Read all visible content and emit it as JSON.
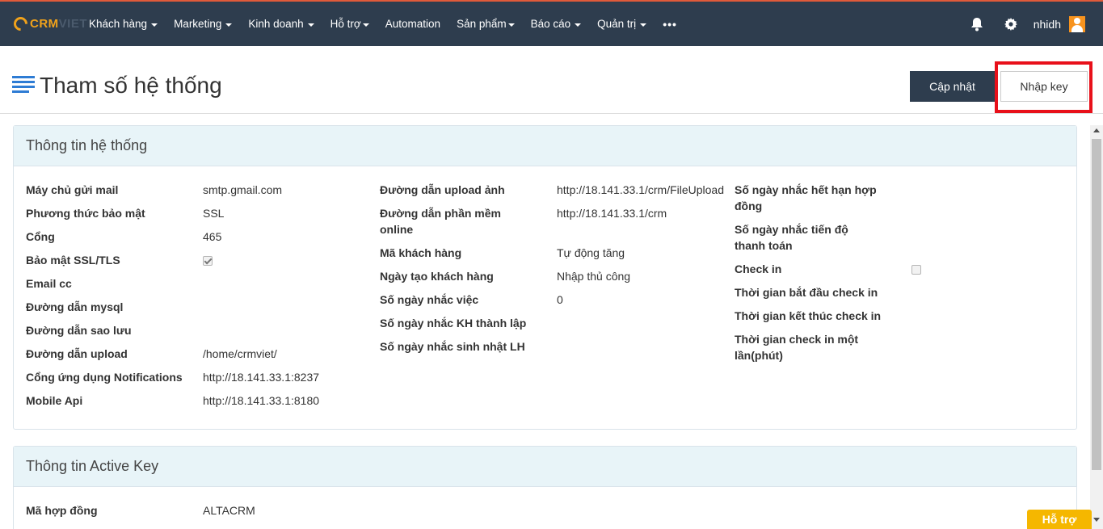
{
  "logo": {
    "part1": "CRM",
    "part2": "VIET"
  },
  "nav": {
    "items": [
      {
        "label": "Khách hàng",
        "dropdown": true
      },
      {
        "label": "Marketing",
        "dropdown": true
      },
      {
        "label": "Kinh doanh",
        "dropdown": true
      },
      {
        "label": "Hỗ trợ",
        "dropdown": true
      },
      {
        "label": "Automation",
        "dropdown": false
      },
      {
        "label": "Sản phẩm",
        "dropdown": true
      },
      {
        "label": "Báo cáo",
        "dropdown": true
      },
      {
        "label": "Quản trị",
        "dropdown": true
      }
    ],
    "more": "•••",
    "username": "nhidh",
    "icons": {
      "notifications": "bell-icon",
      "settings": "gear-icon",
      "user": "avatar-icon",
      "menu": "list-icon"
    }
  },
  "header": {
    "title": "Tham số hệ thống",
    "update_button": "Cập nhật",
    "key_button": "Nhập key"
  },
  "system_panel": {
    "title": "Thông tin hệ thống",
    "col1": [
      {
        "label": "Máy chủ gửi mail",
        "value": "smtp.gmail.com"
      },
      {
        "label": "Phương thức bảo mật",
        "value": "SSL"
      },
      {
        "label": "Cổng",
        "value": "465"
      },
      {
        "label": "Bảo mật SSL/TLS",
        "value": "",
        "checkbox": true,
        "checked": true
      },
      {
        "label": "Email cc",
        "value": ""
      },
      {
        "label": "Đường dẫn mysql",
        "value": ""
      },
      {
        "label": "Đường dẫn sao lưu",
        "value": ""
      },
      {
        "label": "Đường dẫn upload",
        "value": "/home/crmviet/"
      },
      {
        "label": "Cổng ứng dụng Notifications",
        "value": "http://18.141.33.1:8237"
      },
      {
        "label": "Mobile Api",
        "value": "http://18.141.33.1:8180"
      }
    ],
    "col2": [
      {
        "label": "Đường dẫn upload ảnh",
        "value": "http://18.141.33.1/crm/FileUpload"
      },
      {
        "label": "Đường dẫn phần mềm online",
        "value": "http://18.141.33.1/crm"
      },
      {
        "label": "Mã khách hàng",
        "value": "Tự động tăng"
      },
      {
        "label": "Ngày tạo khách hàng",
        "value": "Nhập thủ công"
      },
      {
        "label": "Số ngày nhắc việc",
        "value": "0"
      },
      {
        "label": "Số ngày nhắc KH thành lập",
        "value": ""
      },
      {
        "label": "Số ngày nhắc sinh nhật LH",
        "value": ""
      }
    ],
    "col3": [
      {
        "label": "Số ngày nhắc hết hạn hợp đồng",
        "value": ""
      },
      {
        "label": "Số ngày nhắc tiến độ thanh toán",
        "value": ""
      },
      {
        "label": "Check in",
        "value": "",
        "checkbox": true,
        "checked": false
      },
      {
        "label": "Thời gian bắt đầu check in",
        "value": ""
      },
      {
        "label": "Thời gian kết thúc check in",
        "value": ""
      },
      {
        "label": "Thời gian check in một lần(phút)",
        "value": ""
      }
    ]
  },
  "key_panel": {
    "title": "Thông tin Active Key",
    "rows": [
      {
        "label": "Mã hợp đồng",
        "value": "ALTACRM"
      }
    ]
  },
  "help_button": "Hỗ trợ",
  "colors": {
    "topbar": "#2e3d4e",
    "accent": "#f0a21b",
    "highlight": "#e8101a",
    "panel_head": "#e8f4f8",
    "help": "#f5b700"
  }
}
